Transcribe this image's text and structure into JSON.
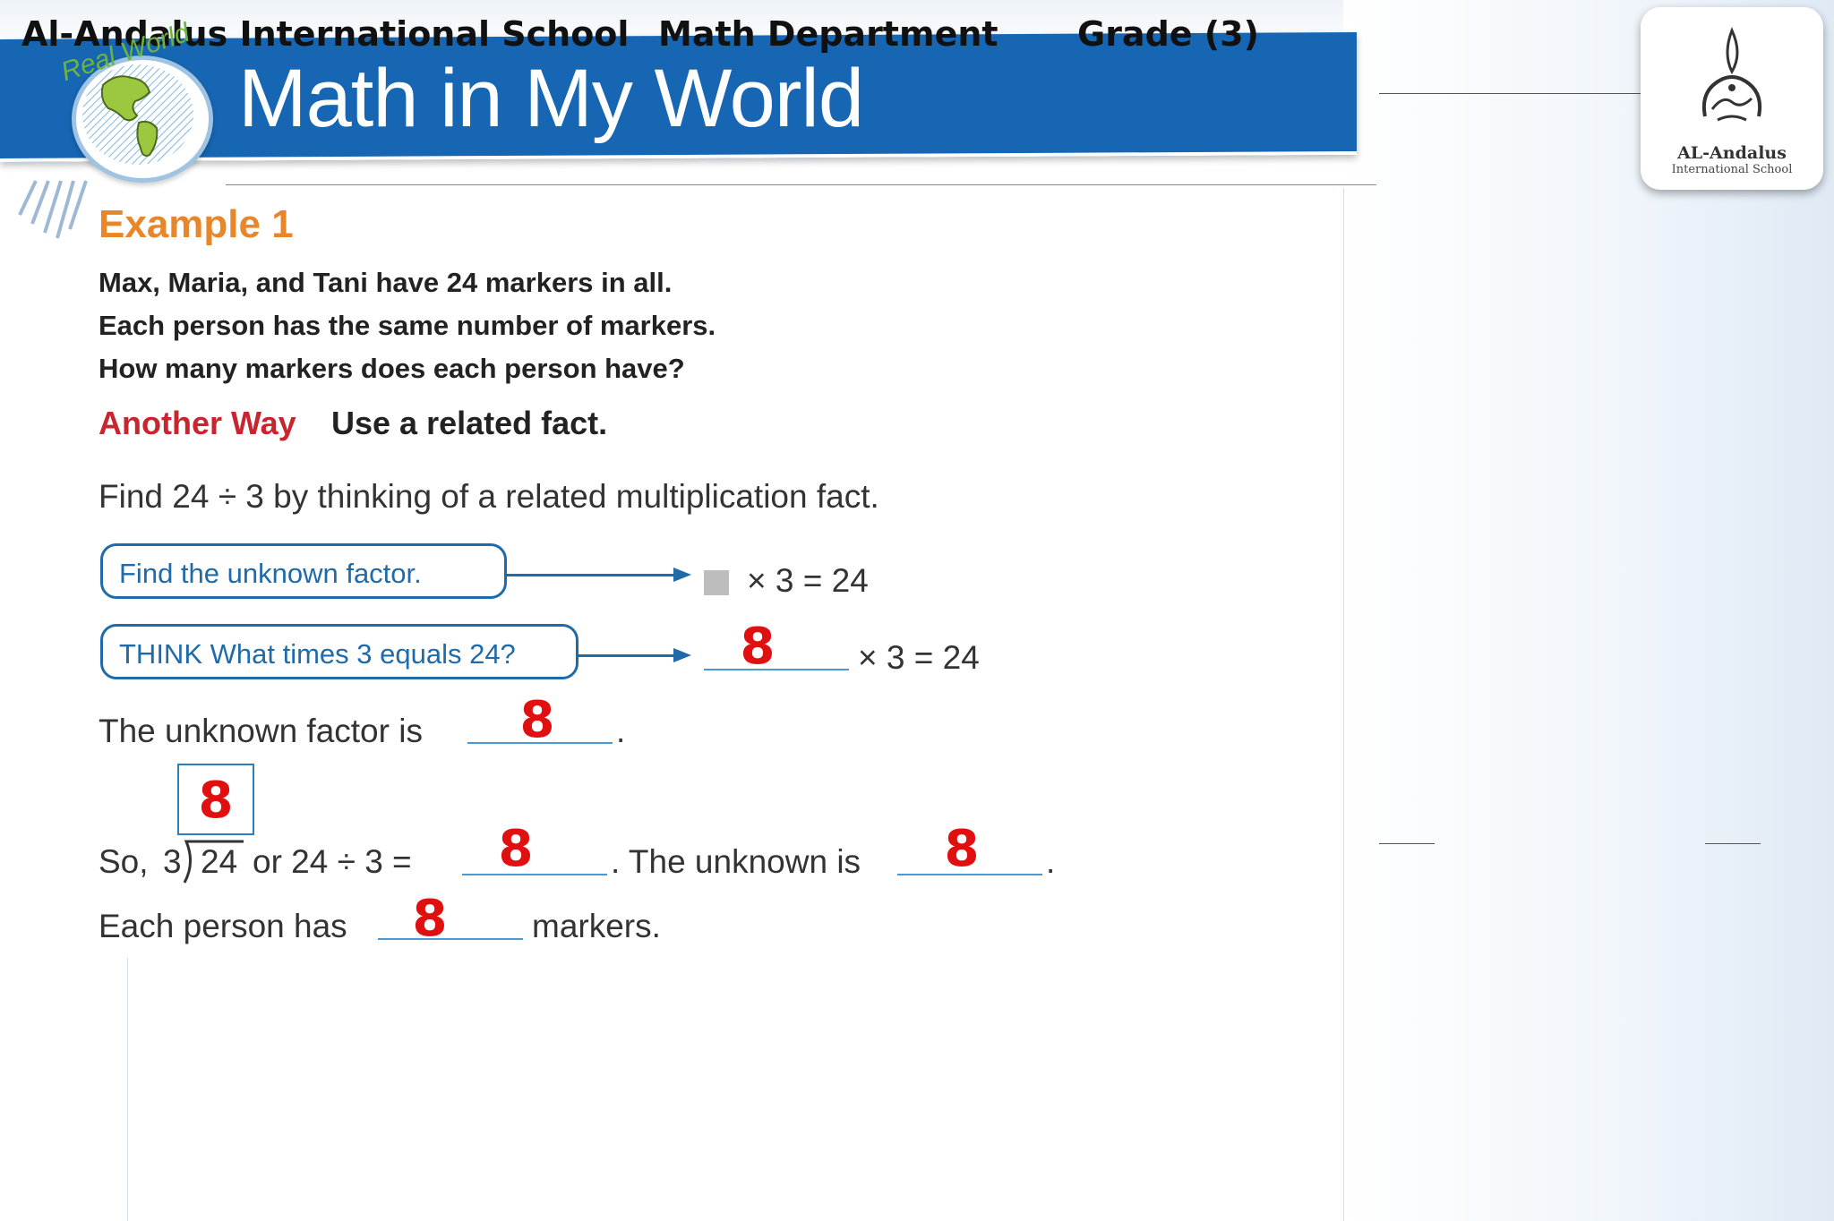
{
  "header": {
    "school": "Al-Andalus International School",
    "department": "Math Department",
    "grade": "Grade (3)",
    "title": "Math in My World",
    "badge": "Real World"
  },
  "logo": {
    "name": "AL-Andalus",
    "subtitle": "International School"
  },
  "example": {
    "title": "Example 1",
    "question": [
      "Max, Maria, and Tani have 24 markers in all.",
      "Each person has the same number of markers.",
      "How many markers does each person have?"
    ],
    "another_way": "Another Way",
    "another_way_text": "Use a related fact.",
    "instruction": "Find 24 ÷ 3 by thinking of a related multiplication fact.",
    "step1_label": "Find the unknown factor.",
    "step1_equation": "× 3 = 24",
    "step2_label": "THINK What times 3 equals 24?",
    "step2_answer": "8",
    "step2_equation": "× 3 = 24",
    "unknown_factor_text": "The unknown factor is",
    "unknown_factor_answer": "8",
    "quotient_answer": "8",
    "so_text": "So,",
    "divisor": "3",
    "dividend": "24",
    "or_text": "or 24 ÷ 3 =",
    "division_answer": "8",
    "unknown_is_text": ". The unknown is",
    "unknown_is_answer": "8",
    "each_person_text": "Each person has",
    "each_person_answer": "8",
    "markers_text": "markers.",
    "period": "."
  },
  "colors": {
    "header_blue": "#1666b4",
    "example_orange": "#e8862a",
    "another_way_red": "#c8262f",
    "answer_red": "#e01010",
    "pill_blue": "#1f6aa8"
  }
}
